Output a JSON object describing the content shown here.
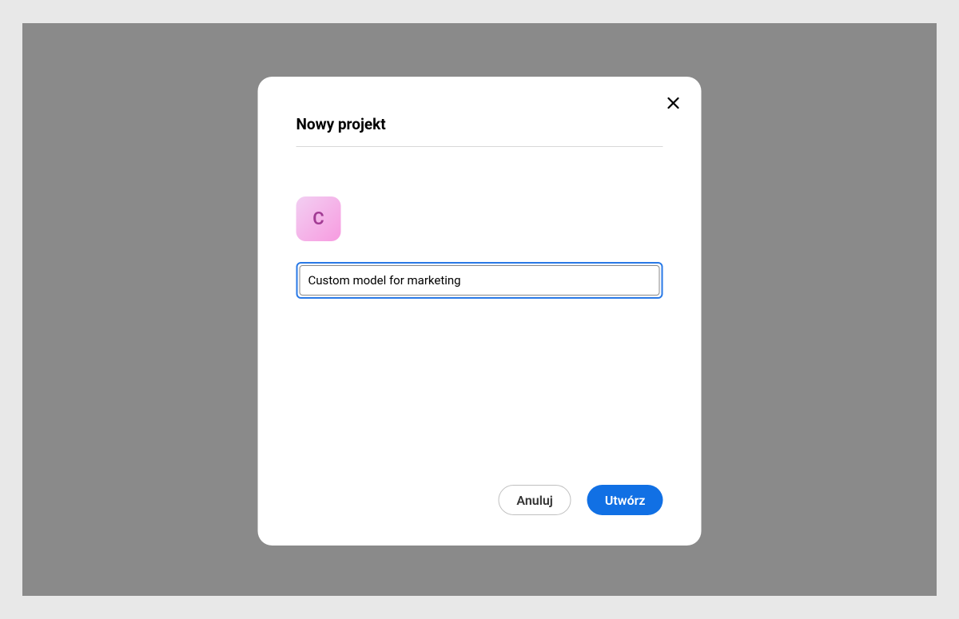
{
  "dialog": {
    "title": "Nowy projekt",
    "icon_letter": "C",
    "input_value": "Custom model for marketing",
    "cancel_label": "Anuluj",
    "create_label": "Utwórz"
  }
}
